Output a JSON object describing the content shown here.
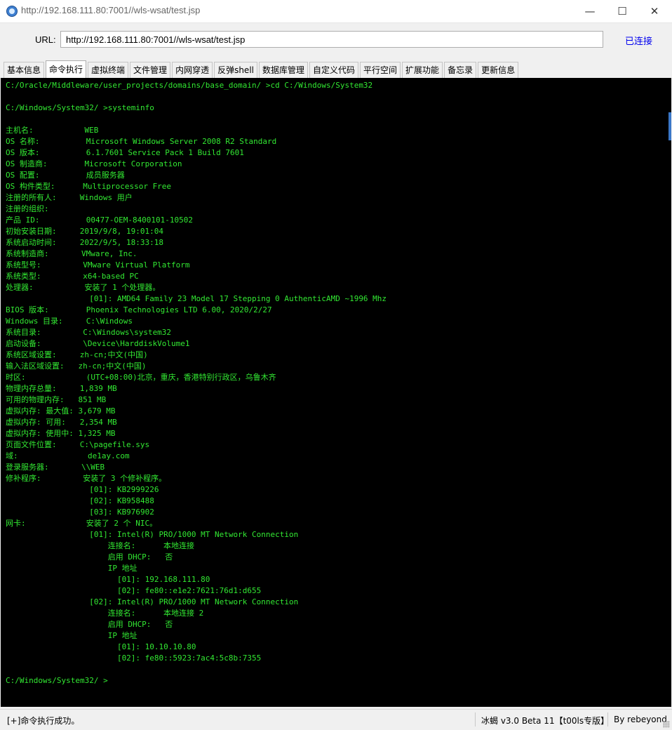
{
  "window": {
    "title": "http://192.168.111.80:7001//wls-wsat/test.jsp",
    "minimize_glyph": "—",
    "maximize_glyph": "☐",
    "close_glyph": "✕"
  },
  "urlbar": {
    "label": "URL:",
    "value": "http://192.168.111.80:7001//wls-wsat/test.jsp",
    "connection_status": "已连接"
  },
  "tabs": [
    {
      "label": "基本信息",
      "active": false
    },
    {
      "label": "命令执行",
      "active": true
    },
    {
      "label": "虚拟终端",
      "active": false
    },
    {
      "label": "文件管理",
      "active": false
    },
    {
      "label": "内网穿透",
      "active": false
    },
    {
      "label": "反弹shell",
      "active": false
    },
    {
      "label": "数据库管理",
      "active": false
    },
    {
      "label": "自定义代码",
      "active": false
    },
    {
      "label": "平行空间",
      "active": false
    },
    {
      "label": "扩展功能",
      "active": false
    },
    {
      "label": "备忘录",
      "active": false
    },
    {
      "label": "更新信息",
      "active": false
    }
  ],
  "console": {
    "text_color": "#32e832",
    "background": "#000000",
    "lines": [
      "C:/Oracle/Middleware/user_projects/domains/base_domain/ >cd C:/Windows/System32",
      "",
      "C:/Windows/System32/ >systeminfo",
      "",
      "主机名:           WEB",
      "OS 名称:          Microsoft Windows Server 2008 R2 Standard",
      "OS 版本:          6.1.7601 Service Pack 1 Build 7601",
      "OS 制造商:        Microsoft Corporation",
      "OS 配置:          成员服务器",
      "OS 构件类型:      Multiprocessor Free",
      "注册的所有人:     Windows 用户",
      "注册的组织:",
      "产品 ID:          00477-OEM-8400101-10502",
      "初始安装日期:     2019/9/8, 19:01:04",
      "系统启动时间:     2022/9/5, 18:33:18",
      "系统制造商:       VMware, Inc.",
      "系统型号:         VMware Virtual Platform",
      "系统类型:         x64-based PC",
      "处理器:           安装了 1 个处理器。",
      "                  [01]: AMD64 Family 23 Model 17 Stepping 0 AuthenticAMD ~1996 Mhz",
      "BIOS 版本:        Phoenix Technologies LTD 6.00, 2020/2/27",
      "Windows 目录:     C:\\Windows",
      "系统目录:         C:\\Windows\\system32",
      "启动设备:         \\Device\\HarddiskVolume1",
      "系统区域设置:     zh-cn;中文(中国)",
      "输入法区域设置:   zh-cn;中文(中国)",
      "时区:             (UTC+08:00)北京，重庆，香港特别行政区，乌鲁木齐",
      "物理内存总量:     1,839 MB",
      "可用的物理内存:   851 MB",
      "虚拟内存: 最大值: 3,679 MB",
      "虚拟内存: 可用:   2,354 MB",
      "虚拟内存: 使用中: 1,325 MB",
      "页面文件位置:     C:\\pagefile.sys",
      "域:               de1ay.com",
      "登录服务器:       \\\\WEB",
      "修补程序:         安装了 3 个修补程序。",
      "                  [01]: KB2999226",
      "                  [02]: KB958488",
      "                  [03]: KB976902",
      "网卡:             安装了 2 个 NIC。",
      "                  [01]: Intel(R) PRO/1000 MT Network Connection",
      "                      连接名:      本地连接",
      "                      启用 DHCP:   否",
      "                      IP 地址",
      "                        [01]: 192.168.111.80",
      "                        [02]: fe80::e1e2:7621:76d1:d655",
      "                  [02]: Intel(R) PRO/1000 MT Network Connection",
      "                      连接名:      本地连接 2",
      "                      启用 DHCP:   否",
      "                      IP 地址",
      "                        [01]: 10.10.10.80",
      "                        [02]: fe80::5923:7ac4:5c8b:7355",
      "",
      "C:/Windows/System32/ >"
    ]
  },
  "statusbar": {
    "message": "[+]命令执行成功。",
    "version": "冰蝎 v3.0 Beta 11【t00ls专版】",
    "author": "By rebeyond"
  }
}
